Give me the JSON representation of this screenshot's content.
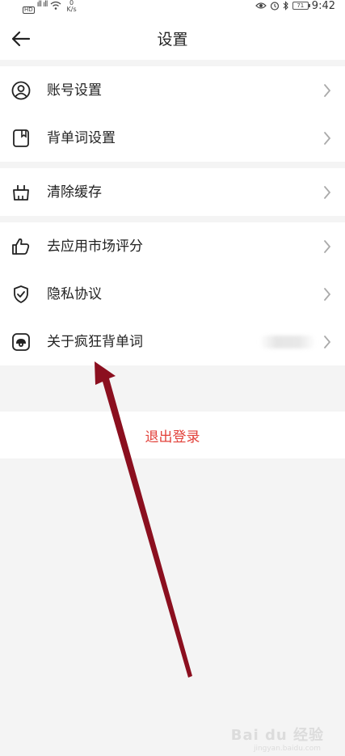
{
  "status_bar": {
    "hd": "HD",
    "signal": "ıll ıll",
    "speed_value": "0",
    "speed_unit": "K/s",
    "battery": "71",
    "time": "9:42"
  },
  "header": {
    "title": "设置"
  },
  "groups": [
    {
      "items": [
        {
          "label": "账号设置",
          "icon": "user-icon"
        },
        {
          "label": "背单词设置",
          "icon": "bookmark-icon"
        }
      ]
    },
    {
      "items": [
        {
          "label": "清除缓存",
          "icon": "broom-icon"
        }
      ]
    },
    {
      "items": [
        {
          "label": "去应用市场评分",
          "icon": "thumbs-up-icon"
        },
        {
          "label": "隐私协议",
          "icon": "shield-check-icon"
        },
        {
          "label": "关于疯狂背单词",
          "icon": "app-logo-icon"
        }
      ]
    }
  ],
  "logout": {
    "label": "退出登录",
    "color": "#e2413a"
  },
  "annotation": {
    "arrow_color": "#8b0f1f"
  },
  "watermark": {
    "text": "Bai du 经验",
    "sub": "jingyan.baidu.com"
  }
}
